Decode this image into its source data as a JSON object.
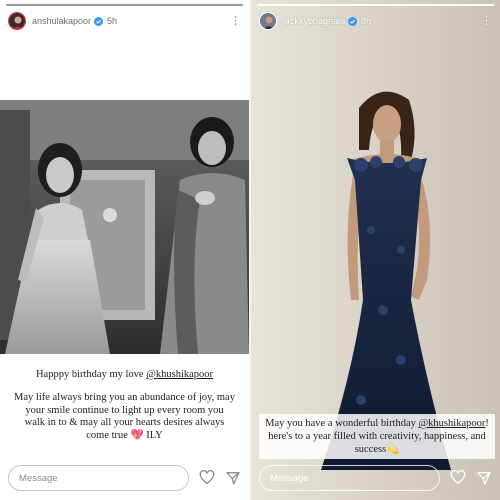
{
  "colors": {
    "mention_heart": "#e0357c",
    "story_bar": "#9a9a9a"
  },
  "left_story": {
    "username": "anshulakapoor",
    "time": "5h",
    "progress": 1.0,
    "avatar_icon": "avatar-pink",
    "caption_line1_prefix": "Happpy birthday my love ",
    "caption_line1_mention": "@khushikapoor",
    "caption_paragraph": "May life always bring you an abundance of joy, may your smile continue to light up every room you walk in to & may all your hearts desires always come true",
    "caption_emoji": "💖",
    "caption_end": " ILY",
    "message_placeholder": "Message"
  },
  "right_story": {
    "username": "jackkybhagnani",
    "time": "8h",
    "progress": 1.0,
    "caption_part1": "May you have a wonderful birthday ",
    "caption_mention": "@khushikapoor",
    "caption_part2": "! here's to a year filled with creativity, happiness, and success",
    "caption_emoji": "💫",
    "message_placeholder": "Message"
  }
}
